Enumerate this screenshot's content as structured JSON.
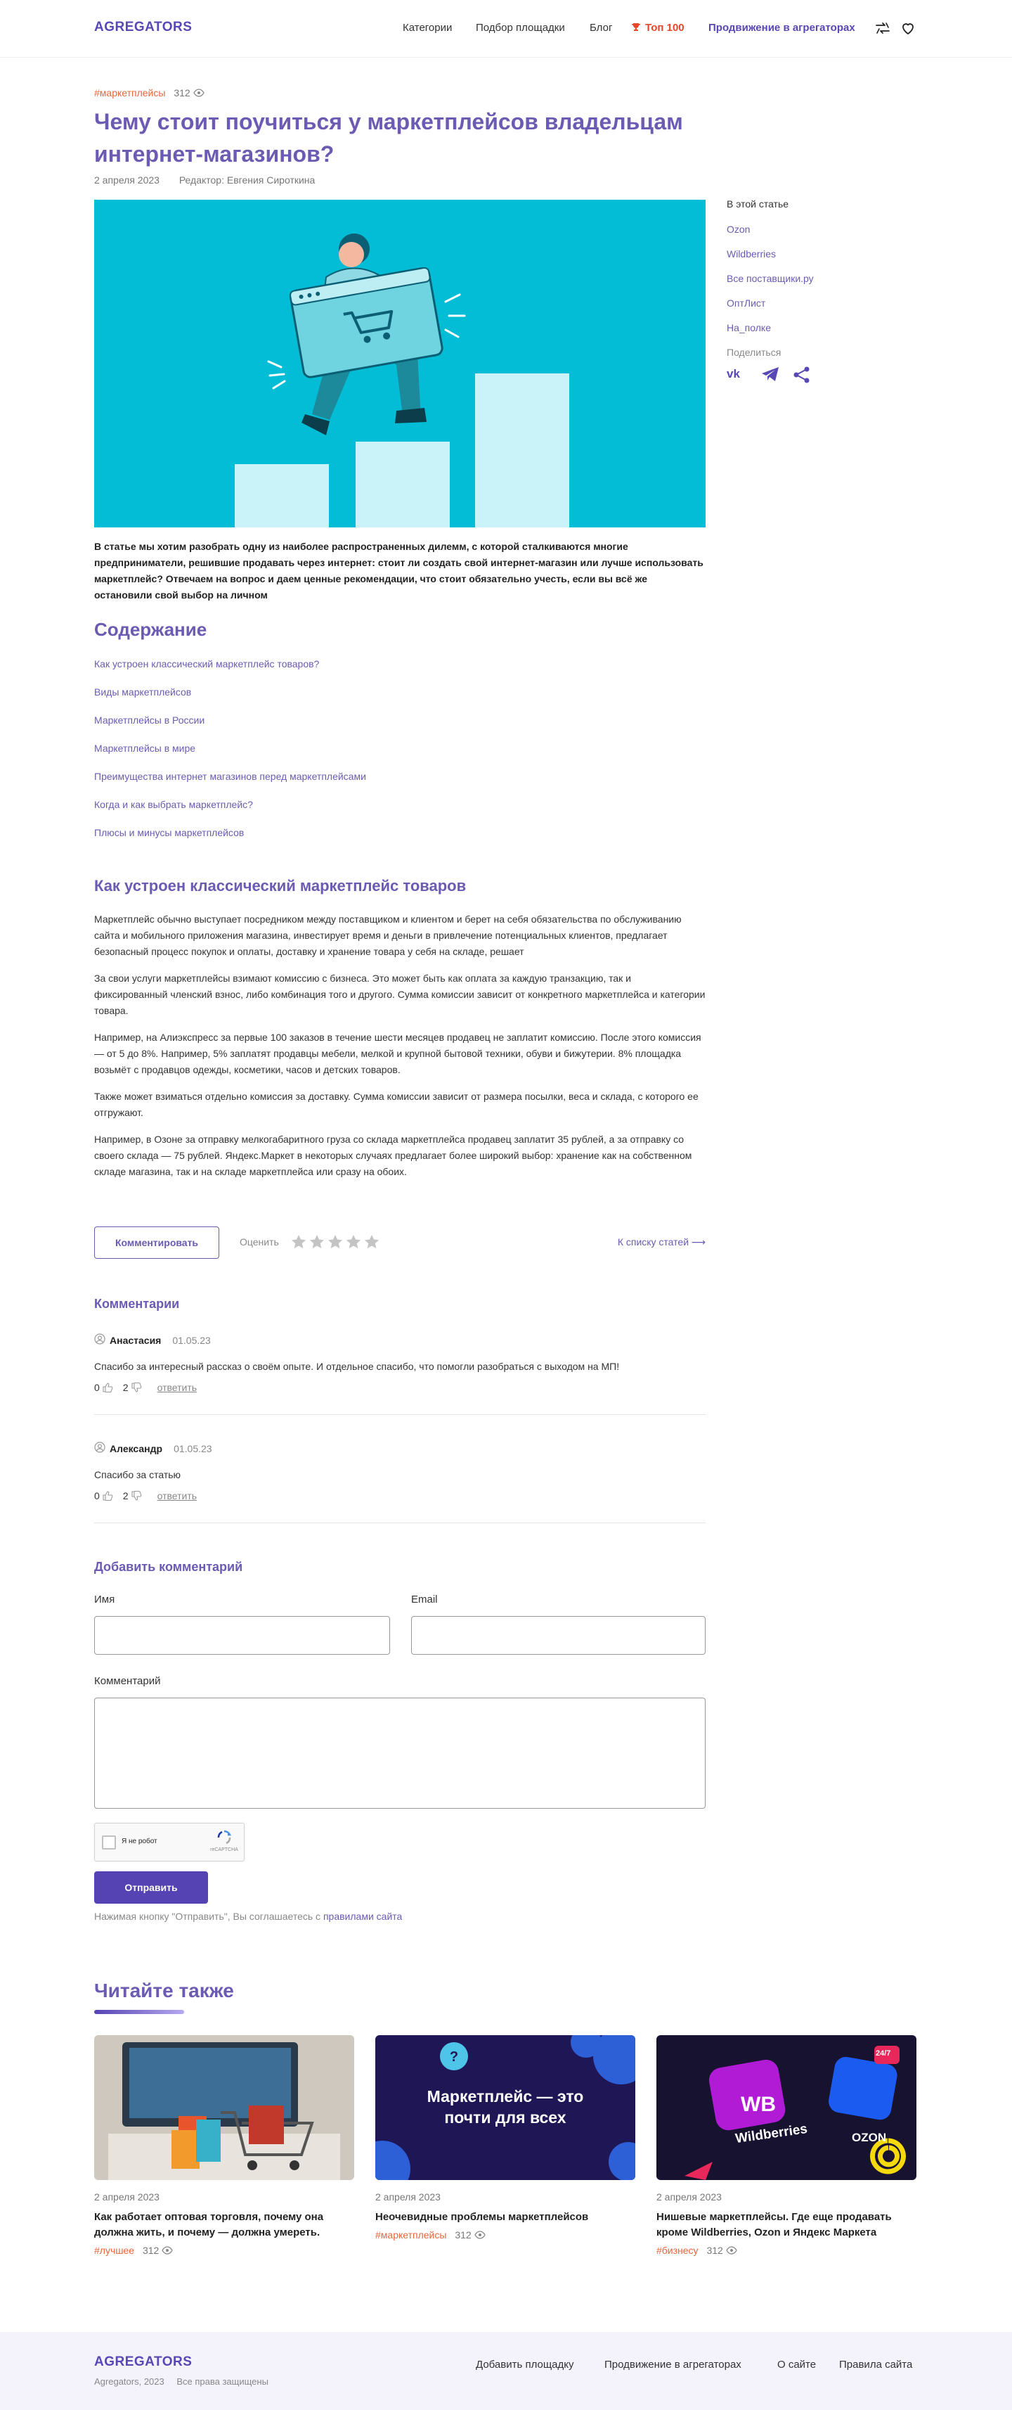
{
  "header": {
    "logo": "AGREGATORS",
    "nav": [
      "Категории",
      "Подбор площадки",
      "Блог"
    ],
    "top": "Топ 100",
    "promo": "Продвижение в агрегаторах"
  },
  "article": {
    "tag": "#маркетплейсы",
    "views": "312",
    "title": "Чему стоит поучиться у маркетплейсов владельцам интернет-магазинов?",
    "date": "2 апреля 2023",
    "editor": "Редактор: Евгения Сироткина",
    "lead": "В статье мы хотим разобрать одну из наиболее распространенных дилемм, с которой сталкиваются многие предприниматели, решившие продавать через интернет: стоит ли создать свой интернет-магазин или лучше использовать маркетплейс? Отвечаем на вопрос и даем ценные рекомендации, что стоит обязательно учесть, если вы всё же остановили свой выбор на личном"
  },
  "sidebar": {
    "title": "В этой статье",
    "links": [
      "Ozon",
      "Wildberries",
      "Все поставщики.ру",
      "ОптЛист",
      "На_полке"
    ],
    "share": "Поделиться"
  },
  "contents": {
    "title": "Содержание",
    "items": [
      "Как устроен классический маркетплейс товаров?",
      "Виды маркетплейсов",
      "Маркетплейсы в России",
      "Маркетплейсы в мире",
      "Преимущества интернет магазинов перед маркетплейсами",
      "Когда и как выбрать маркетплейс?",
      "Плюсы и минусы маркетплейсов"
    ]
  },
  "section": {
    "title": "Как устроен классический маркетплейс товаров",
    "paragraphs": [
      "Маркетплейс обычно выступает посредником между поставщиком и клиентом и берет на себя обязательства по обслуживанию сайта и мобильного приложения магазина, инвестирует время и деньги в привлечение потенциальных клиентов, предлагает безопасный процесс покупок и оплаты, доставку и хранение товара у себя на складе, решает",
      "За свои услуги маркетплейсы взимают комиссию с бизнеса. Это может быть как оплата за каждую транзакцию, так и фиксированный членский взнос, либо комбинация того и другого. Сумма комиссии зависит от конкретного маркетплейса и категории товара.",
      "Например, на Алиэкспресс за первые 100 заказов в течение шести месяцев продавец не заплатит комиссию. После этого комиссия — от 5 до 8%. Например, 5% заплатят продавцы мебели, мелкой и крупной бытовой техники, обуви и бижутерии. 8% площадка возьмёт с продавцов одежды, косметики, часов и детских товаров.",
      "Также может взиматься отдельно комиссия за доставку. Сумма комиссии зависит от размера посылки, веса и склада, с которого ее отгружают.",
      "Например, в Озоне за отправку мелкогабаритного груза со склада маркетплейса продавец заплатит 35 рублей, а за отправку со своего склада — 75 рублей. Яндекс.Маркет в некоторых случаях предлагает более широкий выбор: хранение как на собственном складе магазина, так и на складе маркетплейса или сразу на обоих."
    ]
  },
  "actions": {
    "comment_button": "Комментировать",
    "rate_label": "Оценить",
    "stars": 5,
    "back_link": "К списку статей ⟶"
  },
  "comments": {
    "title": "Комментарии",
    "items": [
      {
        "author": "Анастасия",
        "date": "01.05.23",
        "text": "Спасибо за интересный рассказ о своём опыте. И отдельное спасибо, что помогли разобраться с выходом на МП!",
        "likes": "0",
        "dislikes": "2",
        "reply": "ответить"
      },
      {
        "author": "Александр",
        "date": "01.05.23",
        "text": "Спасибо за статью",
        "likes": "0",
        "dislikes": "2",
        "reply": "ответить"
      }
    ]
  },
  "form": {
    "title": "Добавить комментарий",
    "name_label": "Имя",
    "email_label": "Email",
    "comment_label": "Комментарий",
    "captcha_text": "Я не робот",
    "captcha_brand": "reCAPTCHA",
    "submit": "Отправить",
    "agree_text": "Нажимая кнопку \"Отправить\", Вы соглашаетесь с",
    "agree_link": "правилами сайта"
  },
  "read_also": {
    "title": "Читайте также",
    "cards": [
      {
        "date": "2 апреля 2023",
        "title": "Как работает оптовая торговля, почему она должна жить, и почему — должна умереть.",
        "tag": "#лучшее",
        "views": "312"
      },
      {
        "date": "2 апреля 2023",
        "title": "Неочевидные проблемы маркетплейсов",
        "tag": "#маркетплейсы",
        "views": "312",
        "image_text": "Маркетплейс — это почти для всех"
      },
      {
        "date": "2 апреля 2023",
        "title": "Нишевые маркетплейсы. Где еще продавать кроме Wildberries, Ozon и Яндекс Маркета",
        "tag": "#бизнесу",
        "views": "312",
        "image_labels": [
          "WB",
          "Wildberries",
          "OZON",
          "24/7"
        ]
      }
    ]
  },
  "footer": {
    "logo": "AGREGATORS",
    "copy": "Agregators, 2023",
    "rights": "Все права защищены",
    "links": [
      "Добавить площадку",
      "Продвижение в агрегаторах",
      "О сайте",
      "Правила сайта"
    ]
  },
  "colors": {
    "accent": "#6c5ab3",
    "primary": "#5643b3",
    "tag": "#e8663b",
    "hero_bg": "#02bdd5"
  }
}
